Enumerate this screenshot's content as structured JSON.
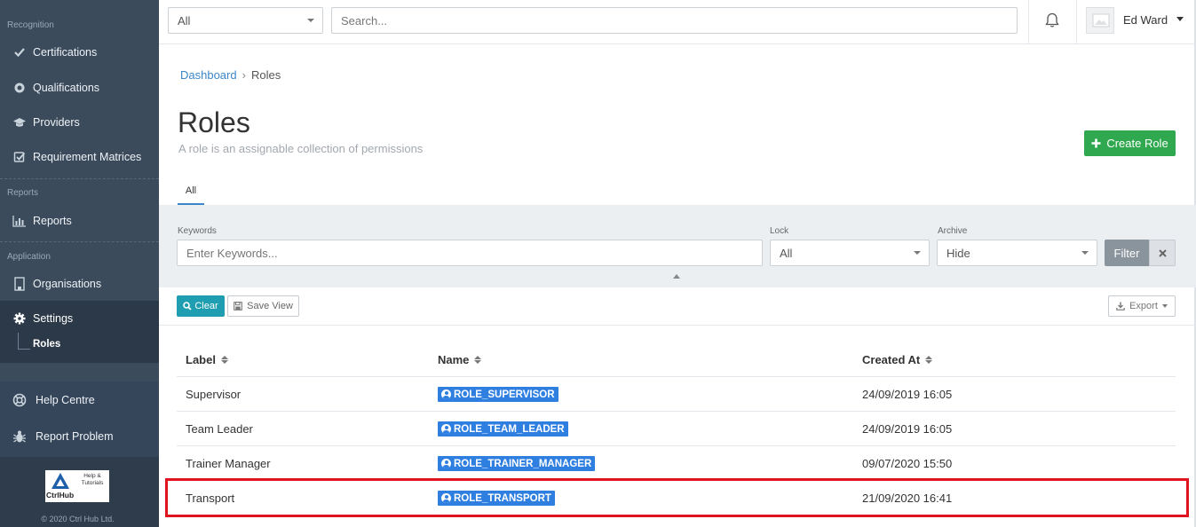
{
  "sidebar": {
    "sections": {
      "recognition": "Recognition",
      "reports": "Reports",
      "application": "Application"
    },
    "items": {
      "certifications": "Certifications",
      "qualifications": "Qualifications",
      "providers": "Providers",
      "requirement_matrices": "Requirement Matrices",
      "reports": "Reports",
      "organisations": "Organisations",
      "settings": "Settings",
      "roles": "Roles",
      "help_centre": "Help Centre",
      "report_problem": "Report Problem"
    },
    "logo": {
      "brand": "CtrlHub",
      "help_text": "Help & Tutorials"
    },
    "copyright": "© 2020 Ctrl Hub Ltd."
  },
  "topbar": {
    "scope_select": "All",
    "search_placeholder": "Search...",
    "user_name": "Ed Ward"
  },
  "breadcrumb": {
    "home": "Dashboard",
    "separator": "›",
    "current": "Roles"
  },
  "page": {
    "title": "Roles",
    "subtitle": "A role is an assignable collection of permissions",
    "create_button": "Create Role",
    "tab_all": "All"
  },
  "filters": {
    "keywords_label": "Keywords",
    "keywords_placeholder": "Enter Keywords...",
    "lock_label": "Lock",
    "lock_value": "All",
    "archive_label": "Archive",
    "archive_value": "Hide",
    "filter_button": "Filter"
  },
  "toolbar": {
    "clear_label": "Clear",
    "save_view_label": "Save View",
    "export_label": "Export"
  },
  "table": {
    "headers": [
      "Label",
      "Name",
      "Created At"
    ],
    "rows": [
      {
        "label": "Supervisor",
        "name": "ROLE_SUPERVISOR",
        "created_at": "24/09/2019 16:05"
      },
      {
        "label": "Team Leader",
        "name": "ROLE_TEAM_LEADER",
        "created_at": "24/09/2019 16:05"
      },
      {
        "label": "Trainer Manager",
        "name": "ROLE_TRAINER_MANAGER",
        "created_at": "09/07/2020 15:50"
      },
      {
        "label": "Transport",
        "name": "ROLE_TRANSPORT",
        "created_at": "21/09/2020 16:41"
      }
    ]
  },
  "colors": {
    "sidebar_bg": "#3b4b5c",
    "primary_link": "#3a86c9",
    "create_green": "#2fa84f",
    "badge_blue": "#2f7fe0",
    "clear_teal": "#1f9eb1",
    "highlight_red": "#e0141e"
  }
}
